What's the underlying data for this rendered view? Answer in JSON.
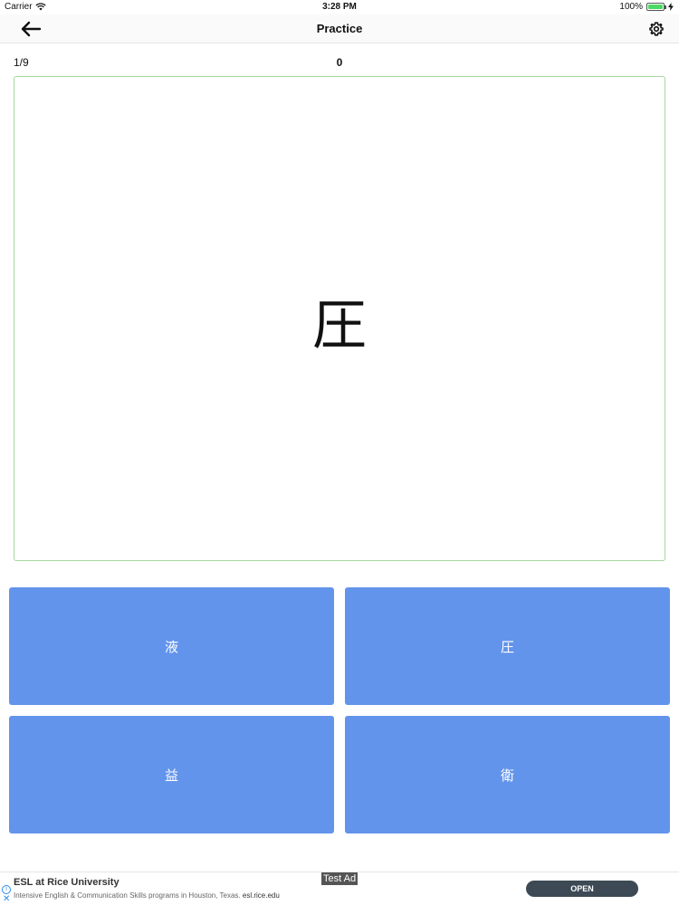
{
  "status_bar": {
    "carrier": "Carrier",
    "time": "3:28 PM",
    "battery": "100%"
  },
  "nav": {
    "title": "Practice",
    "back_icon": "arrow-left-icon",
    "settings_icon": "gear-icon"
  },
  "quiz": {
    "progress": "1/9",
    "score": "0",
    "question": "圧",
    "answers": [
      "液",
      "圧",
      "益",
      "衛"
    ]
  },
  "ad": {
    "tag": "Test Ad",
    "title": "ESL at Rice University",
    "body": "Intensive English & Communication Skills programs in Houston, Texas.",
    "url": "esl.rice.edu",
    "cta": "OPEN"
  },
  "colors": {
    "answer_bg": "#6394eb",
    "card_border": "#a8d8a0",
    "battery": "#4cd964",
    "ad_button": "#3d4a55"
  }
}
